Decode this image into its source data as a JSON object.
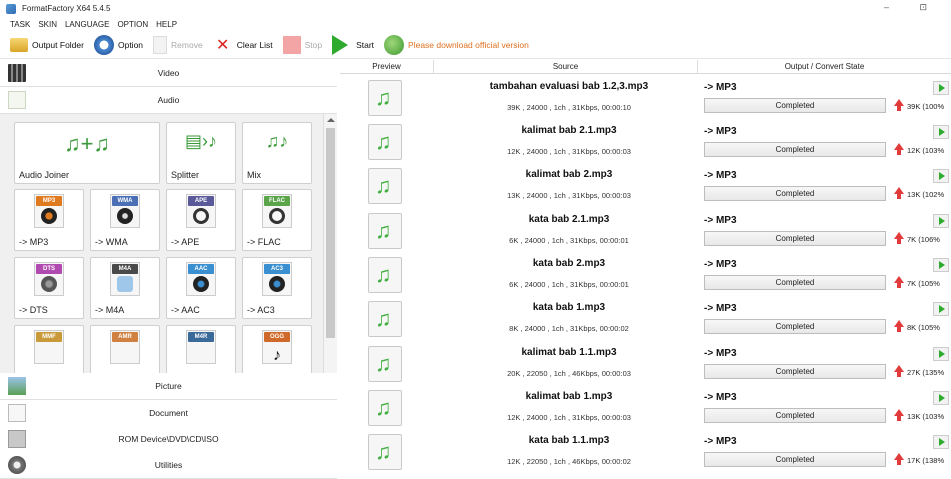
{
  "app": {
    "title": "FormatFactory X64 5.4.5",
    "window_controls": "–  ⊡"
  },
  "menu": [
    "TASK",
    "SKIN",
    "LANGUAGE",
    "OPTION",
    "HELP"
  ],
  "toolbar": {
    "output_folder": "Output Folder",
    "option": "Option",
    "remove": "Remove",
    "clear_list": "Clear List",
    "stop": "Stop",
    "start": "Start",
    "download_notice": "Please download official version"
  },
  "categories": {
    "video": "Video",
    "audio": "Audio",
    "picture": "Picture",
    "document": "Document",
    "rom": "ROM Device\\DVD\\CD\\ISO",
    "utilities": "Utilities"
  },
  "audio_tiles": {
    "joiner": "Audio Joiner",
    "splitter": "Splitter",
    "mix": "Mix",
    "formats": [
      {
        "badge": "MP3",
        "label": "-> MP3",
        "color": "#e07a1f"
      },
      {
        "badge": "WMA",
        "label": "-> WMA",
        "color": "#4a6fb5"
      },
      {
        "badge": "APE",
        "label": "-> APE",
        "color": "#5a5a9a"
      },
      {
        "badge": "FLAC",
        "label": "-> FLAC",
        "color": "#5aa54a"
      },
      {
        "badge": "DTS",
        "label": "-> DTS",
        "color": "#b04ab0"
      },
      {
        "badge": "M4A",
        "label": "-> M4A",
        "color": "#4a4a4a"
      },
      {
        "badge": "AAC",
        "label": "-> AAC",
        "color": "#3a8fd0"
      },
      {
        "badge": "AC3",
        "label": "-> AC3",
        "color": "#3a8fd0"
      },
      {
        "badge": "MMF",
        "label": "",
        "color": "#c89a3a"
      },
      {
        "badge": "AMR",
        "label": "",
        "color": "#d08040"
      },
      {
        "badge": "M4R",
        "label": "",
        "color": "#3a6a9a"
      },
      {
        "badge": "OGG",
        "label": "",
        "color": "#d06a2a"
      }
    ]
  },
  "table": {
    "headers": [
      "Preview",
      "Source",
      "Output / Convert State"
    ],
    "rows": [
      {
        "name": "tambahan evaluasi bab 1.2,3.mp3",
        "info": "39K , 24000 , 1ch , 31Kbps, 00:00:10",
        "target": "-> MP3",
        "status": "Completed",
        "result": "39K (100%"
      },
      {
        "name": "kalimat bab 2.1.mp3",
        "info": "12K , 24000 , 1ch , 31Kbps, 00:00:03",
        "target": "-> MP3",
        "status": "Completed",
        "result": "12K (103%"
      },
      {
        "name": "kalimat bab 2.mp3",
        "info": "13K , 24000 , 1ch , 31Kbps, 00:00:03",
        "target": "-> MP3",
        "status": "Completed",
        "result": "13K (102%"
      },
      {
        "name": "kata bab 2.1.mp3",
        "info": "6K , 24000 , 1ch , 31Kbps, 00:00:01",
        "target": "-> MP3",
        "status": "Completed",
        "result": "7K (106%"
      },
      {
        "name": "kata bab 2.mp3",
        "info": "6K , 24000 , 1ch , 31Kbps, 00:00:01",
        "target": "-> MP3",
        "status": "Completed",
        "result": "7K (105%"
      },
      {
        "name": "kata bab 1.mp3",
        "info": "8K , 24000 , 1ch , 31Kbps, 00:00:02",
        "target": "-> MP3",
        "status": "Completed",
        "result": "8K (105%"
      },
      {
        "name": "kalimat bab 1.1.mp3",
        "info": "20K , 22050 , 1ch , 46Kbps, 00:00:03",
        "target": "-> MP3",
        "status": "Completed",
        "result": "27K (135%"
      },
      {
        "name": "kalimat bab 1.mp3",
        "info": "12K , 24000 , 1ch , 31Kbps, 00:00:03",
        "target": "-> MP3",
        "status": "Completed",
        "result": "13K (103%"
      },
      {
        "name": "kata bab 1.1.mp3",
        "info": "12K , 22050 , 1ch , 46Kbps, 00:00:02",
        "target": "-> MP3",
        "status": "Completed",
        "result": "17K (138%"
      }
    ]
  }
}
